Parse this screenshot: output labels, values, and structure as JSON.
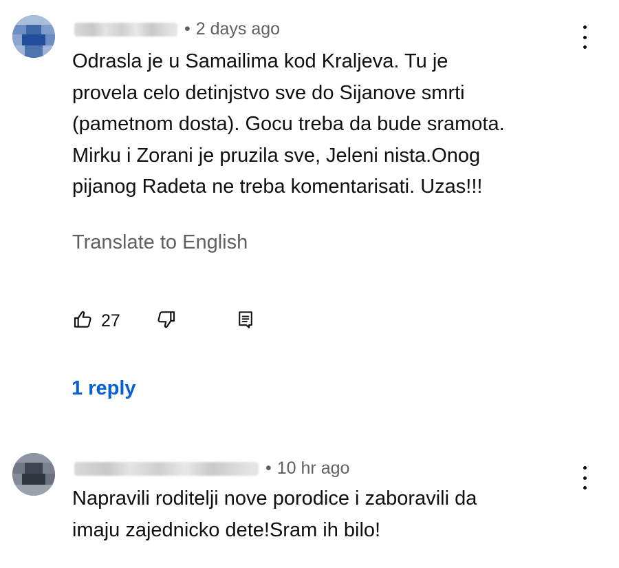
{
  "comments": [
    {
      "author_redacted": true,
      "timestamp": "2 days ago",
      "separator": "•",
      "text": "Odrasla je u Samailima kod Kraljeva. Tu je\nprovela celo detinjstvo sve do Sijanove smrti\n(pametnom dosta). Gocu treba da bude sramota.\nMirku i Zorani je pruzila sve, Jeleni nista.Onog\npijanog Radeta ne treba komentarisati. Uzas!!!",
      "translate_label": "Translate to English",
      "like_count": "27",
      "replies_label": "1 reply",
      "icons": [
        "avatar",
        "more-vert-icon",
        "thumbs-up-icon",
        "thumbs-down-icon",
        "reply-icon"
      ]
    },
    {
      "author_redacted": true,
      "timestamp": "10 hr ago",
      "separator": "•",
      "text": "Napravili roditelji nove porodice i zaboravili da\nimaju zajednicko dete!Sram ih bilo!",
      "icons": [
        "avatar",
        "more-vert-icon"
      ]
    }
  ],
  "colors": {
    "text": "#0f0f0f",
    "secondary": "#606060",
    "link": "#065fd4"
  }
}
